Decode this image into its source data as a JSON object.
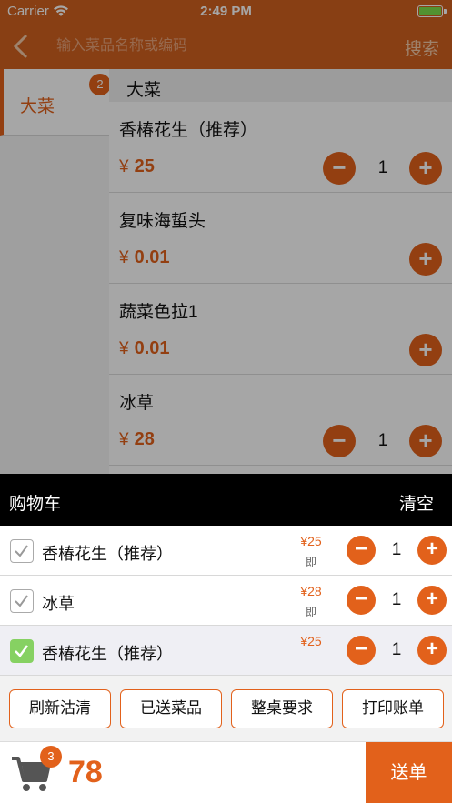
{
  "colors": {
    "accent": "#e2611b",
    "navbar": "#d2621f",
    "check_on": "#86d162"
  },
  "status": {
    "carrier": "Carrier",
    "time": "2:49 PM"
  },
  "nav": {
    "search_placeholder": "输入菜品名称或编码",
    "search_label": "搜索",
    "back_icon": "chevron-left-icon"
  },
  "sidebar": {
    "items": [
      {
        "label": "大菜",
        "badge": "2"
      }
    ]
  },
  "section": {
    "title": "大菜"
  },
  "dishes": [
    {
      "name": "香椿花生（推荐）",
      "currency": "¥",
      "price": "25",
      "qty": "1",
      "has_minus": true
    },
    {
      "name": "复味海蜇头",
      "currency": "¥",
      "price": "0.01",
      "has_minus": false
    },
    {
      "name": "蔬菜色拉1",
      "currency": "¥",
      "price": "0.01",
      "has_minus": false
    },
    {
      "name": "冰草",
      "currency": "¥",
      "price": "28",
      "qty": "1",
      "has_minus": true
    }
  ],
  "cart": {
    "title": "购物车",
    "clear_label": "清空",
    "items": [
      {
        "name": "香椿花生（推荐）",
        "price": "¥25",
        "tag": "即",
        "qty": "1",
        "checked": false
      },
      {
        "name": "冰草",
        "price": "¥28",
        "tag": "即",
        "qty": "1",
        "checked": false
      },
      {
        "name": "香椿花生（推荐）",
        "price": "¥25",
        "tag": "",
        "qty": "1",
        "checked": true
      }
    ]
  },
  "actions": [
    "刷新沽清",
    "已送菜品",
    "整桌要求",
    "打印账单"
  ],
  "bottom": {
    "cart_count": "3",
    "total": "78",
    "submit_label": "送单"
  },
  "glyphs": {
    "minus": "−",
    "plus": "+"
  }
}
